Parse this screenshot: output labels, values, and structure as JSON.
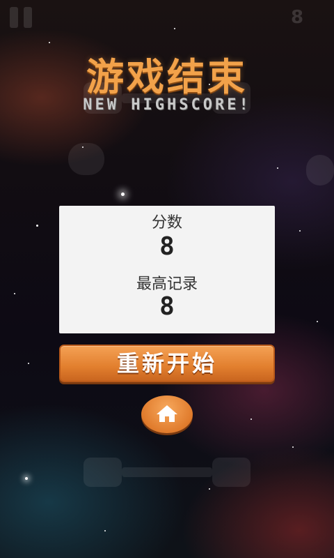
{
  "game": {
    "title": "游戏结束",
    "subtitle": "NEW HIGHSCORE!",
    "top_score_indicator": "8"
  },
  "panel": {
    "score_label": "分数",
    "score_value": "8",
    "best_label": "最高记录",
    "best_value": "8"
  },
  "buttons": {
    "restart_label": "重新开始",
    "home_icon": "home-icon"
  },
  "colors": {
    "accent": "#f2a24a",
    "button": "#e27f2e",
    "panel": "#f3f3f3"
  }
}
